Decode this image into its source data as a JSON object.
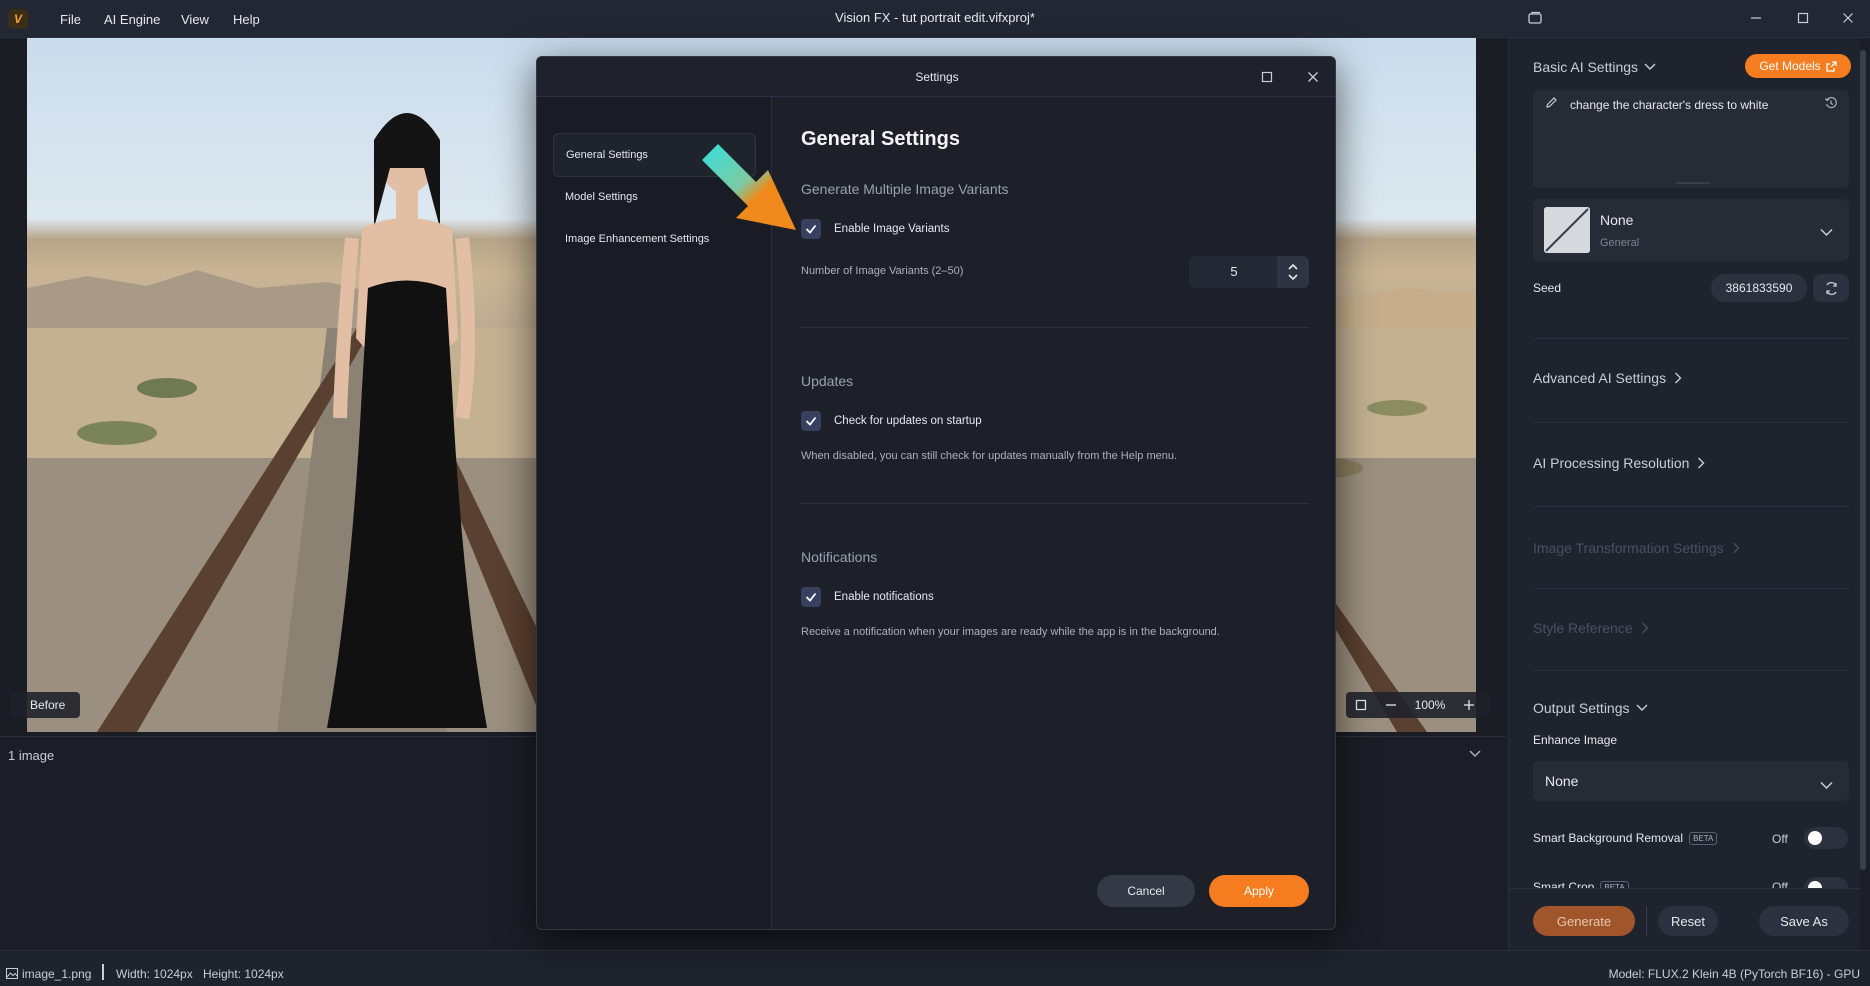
{
  "window": {
    "title": "Vision FX - tut portrait edit.vifxproj*",
    "menu": [
      "File",
      "AI Engine",
      "View",
      "Help"
    ]
  },
  "canvas": {
    "before_label": "Before",
    "zoom": "100%",
    "image_count": "1 image"
  },
  "status": {
    "file": "image_1.png",
    "width": "Width: 1024px",
    "height": "Height: 1024px",
    "model": "Model: FLUX.2 Klein 4B (PyTorch BF16) - GPU"
  },
  "panel": {
    "basic_title": "Basic AI Settings",
    "get_models": "Get Models",
    "prompt": "change the character's dress to white",
    "style_name": "None",
    "style_category": "General",
    "seed_label": "Seed",
    "seed_value": "3861833590",
    "advanced": "Advanced AI Settings",
    "resolution": "AI Processing Resolution",
    "transformation": "Image Transformation Settings",
    "style_ref": "Style Reference",
    "output": "Output Settings",
    "enhance_label": "Enhance Image",
    "enhance_value": "None",
    "bg_removal": "Smart Background Removal",
    "bg_removal_state": "Off",
    "smart_crop": "Smart Crop",
    "smart_crop_state": "Off",
    "beta": "BETA",
    "generate": "Generate",
    "reset": "Reset",
    "save_as": "Save As"
  },
  "dialog": {
    "title": "Settings",
    "nav": [
      "General Settings",
      "Model Settings",
      "Image Enhancement Settings"
    ],
    "heading": "General Settings",
    "variants_section": "Generate Multiple Image Variants",
    "enable_variants": "Enable Image Variants",
    "variants_count_label": "Number of Image Variants (2–50)",
    "variants_count": "5",
    "updates_section": "Updates",
    "check_updates": "Check for updates on startup",
    "updates_help": "When disabled, you can still check for updates manually from the Help menu.",
    "notifications_section": "Notifications",
    "enable_notifications": "Enable notifications",
    "notifications_help": "Receive a notification when your images are ready while the app is in the background.",
    "cancel": "Cancel",
    "apply": "Apply"
  },
  "colors": {
    "accent": "#f57c1f",
    "checkbox": "#384060",
    "arrow": "#f08a1c",
    "arrow_tail": "#34e0e0"
  }
}
